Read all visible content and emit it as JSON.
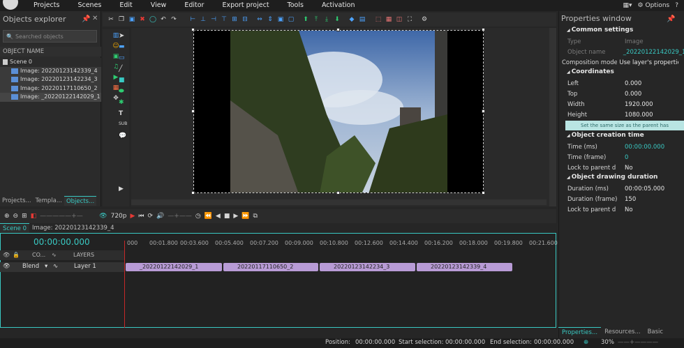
{
  "menu": {
    "items": [
      "Projects",
      "Scenes",
      "Edit",
      "View",
      "Editor",
      "Export project",
      "Tools",
      "Activation"
    ],
    "options": "Options"
  },
  "explorer": {
    "title": "Objects explorer",
    "search_placeholder": "Searched objects",
    "column": "OBJECT NAME",
    "tree": [
      "Scene 0",
      "Image: 20220123142339_4",
      "Image: 20220123142234_3",
      "Image: 20220117110650_2",
      "Image: _20220122142029_1"
    ],
    "tabs": [
      "Projects...",
      "Templa...",
      "Objects..."
    ]
  },
  "properties": {
    "title": "Properties window",
    "common": "Common settings",
    "type_k": "Type",
    "type_v": "Image",
    "objname_k": "Object name",
    "objname_v": "_20220122142029_1",
    "compmode_k": "Composition mode",
    "compmode_v": "Use layer's properties",
    "coords": "Coordinates",
    "left_k": "Left",
    "left_v": "0.000",
    "top_k": "Top",
    "top_v": "0.000",
    "width_k": "Width",
    "width_v": "1920.000",
    "height_k": "Height",
    "height_v": "1080.000",
    "note": "Set the same size as the parent has",
    "creation": "Object creation time",
    "time_ms_k": "Time (ms)",
    "time_ms_v": "00:00:00.000",
    "time_frame_k": "Time (frame)",
    "time_frame_v": "0",
    "lock1_k": "Lock to parent d",
    "lock1_v": "No",
    "drawing": "Object drawing duration",
    "dur_ms_k": "Duration (ms)",
    "dur_ms_v": "00:00:05.000",
    "dur_frame_k": "Duration (frame)",
    "dur_frame_v": "150",
    "lock2_k": "Lock to parent d",
    "lock2_v": "No",
    "tabs": [
      "Properties...",
      "Resources...",
      "Basic effec..."
    ]
  },
  "controls": {
    "quality": "720p"
  },
  "scene_tabs": [
    "Scene 0",
    "Image: 20220123142339_4"
  ],
  "timeline": {
    "time": "00:00:00.000",
    "co_label": "CO...",
    "layers_label": "LAYERS",
    "blend": "Blend",
    "layer": "Layer 1",
    "ruler": [
      "000",
      "00:01.800",
      "00:03.600",
      "00:05.400",
      "00:07.200",
      "00:09.000",
      "00:10.800",
      "00:12.600",
      "00:14.400",
      "00:16.200",
      "00:18.000",
      "00:19.800",
      "00:21.600"
    ],
    "clips": [
      "_20220122142029_1",
      "20220117110650_2",
      "20220123142234_3",
      "20220123142339_4"
    ]
  },
  "status": {
    "position_k": "Position:",
    "position_v": "00:00:00.000",
    "start_k": "Start selection:",
    "start_v": "00:00:00.000",
    "end_k": "End selection:",
    "end_v": "00:00:00.000",
    "zoom": "30%"
  }
}
